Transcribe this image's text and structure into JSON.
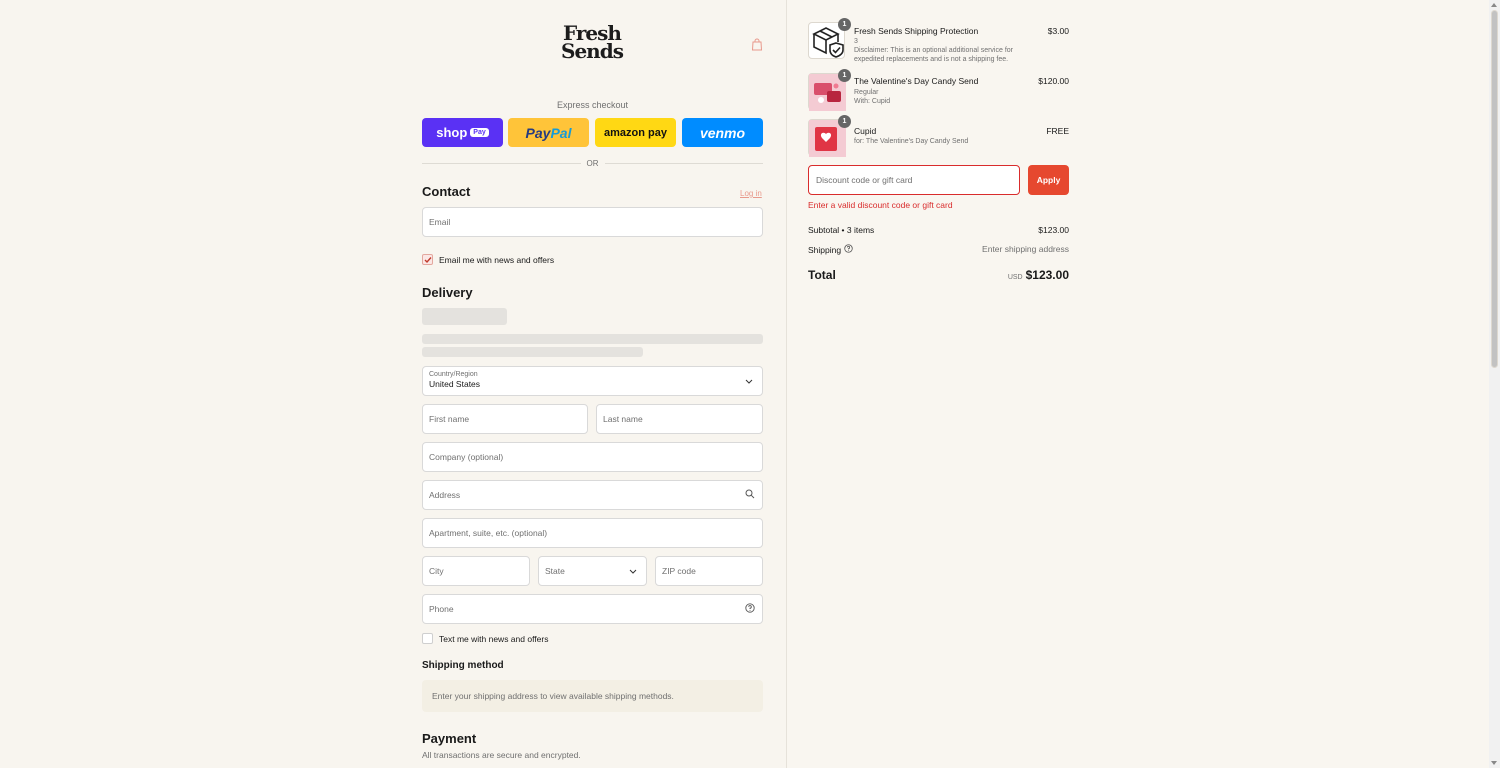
{
  "brand": {
    "line1": "Fresh",
    "line2": "Sends"
  },
  "express": {
    "label": "Express checkout",
    "shop_pay": "shop",
    "shop_pay_pill": "Pay",
    "paypal_a": "Pay",
    "paypal_b": "Pal",
    "amazon_pay": "amazon pay",
    "venmo": "venmo"
  },
  "or_label": "OR",
  "contact": {
    "title": "Contact",
    "login": "Log in",
    "email_placeholder": "Email",
    "newsletter_label": "Email me with news and offers",
    "newsletter_checked": true
  },
  "delivery": {
    "title": "Delivery",
    "country_label": "Country/Region",
    "country_value": "United States",
    "first_name": "First name",
    "last_name": "Last name",
    "company": "Company (optional)",
    "address": "Address",
    "apartment": "Apartment, suite, etc. (optional)",
    "city": "City",
    "state": "State",
    "zip": "ZIP code",
    "phone": "Phone",
    "sms_label": "Text me with news and offers"
  },
  "shipping_method": {
    "title": "Shipping method",
    "note": "Enter your shipping address to view available shipping methods."
  },
  "payment": {
    "title": "Payment",
    "subtitle": "All transactions are secure and encrypted."
  },
  "summary": {
    "items": [
      {
        "qty": "1",
        "name": "Fresh Sends Shipping Protection",
        "sub1": "3",
        "sub2": "Disclaimer: This is an optional additional service for expedited replacements and is not a shipping fee.",
        "price": "$3.00"
      },
      {
        "qty": "1",
        "name": "The Valentine's Day Candy Send",
        "sub1": "Regular",
        "sub2": "With: Cupid",
        "price": "$120.00"
      },
      {
        "qty": "1",
        "name": "Cupid",
        "sub1": "for: The Valentine's Day Candy Send",
        "price": "FREE"
      }
    ],
    "discount_placeholder": "Discount code or gift card",
    "apply_label": "Apply",
    "error": "Enter a valid discount code or gift card",
    "subtotal_label": "Subtotal • 3 items",
    "subtotal_value": "$123.00",
    "shipping_label": "Shipping",
    "shipping_value": "Enter shipping address",
    "total_label": "Total",
    "currency": "USD",
    "total_value": "$123.00"
  },
  "colors": {
    "accent": "#e6482f",
    "error": "#d92c2c",
    "shop_pay": "#5a31f4",
    "paypal": "#ffc439",
    "amazon": "#ffd814",
    "venmo": "#008cff"
  }
}
